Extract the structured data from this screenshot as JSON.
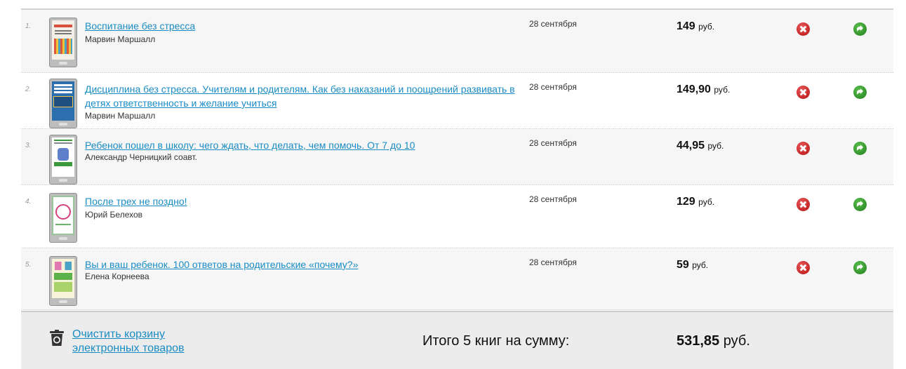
{
  "cart": {
    "items": [
      {
        "num": "1.",
        "title": "Воспитание без стресса",
        "author": "Марвин Маршалл",
        "date": "28 сентября",
        "price": "149",
        "currency": "руб."
      },
      {
        "num": "2.",
        "title": "Дисциплина без стресса. Учителям и родителям. Как без наказаний и поощрений развивать в детях ответственность и желание учиться",
        "author": "Марвин Маршалл",
        "date": "28 сентября",
        "price": "149,90",
        "currency": "руб."
      },
      {
        "num": "3.",
        "title": "Ребенок пошел в школу: чего ждать, что делать, чем помочь. От 7 до 10",
        "author": "Александр Черницкий соавт.",
        "date": "28 сентября",
        "price": "44,95",
        "currency": "руб."
      },
      {
        "num": "4.",
        "title": "После трех не поздно!",
        "author": "Юрий Белехов",
        "date": "28 сентября",
        "price": "129",
        "currency": "руб."
      },
      {
        "num": "5.",
        "title": "Вы и ваш ребенок. 100 ответов на родительские «почему?»",
        "author": "Елена Корнеева",
        "date": "28 сентября",
        "price": "59",
        "currency": "руб."
      }
    ]
  },
  "cover_covers": [
    {
      "bg": "#f3efe6",
      "accent": "#d7503a"
    },
    {
      "bg": "#2b6fae",
      "accent": "#ffffff"
    },
    {
      "bg": "#ffffff",
      "accent": "#3a9a3a"
    },
    {
      "bg": "#ffffff",
      "accent": "#d4417b"
    },
    {
      "bg": "#f7f3d8",
      "accent": "#5bb14a"
    }
  ],
  "footer": {
    "clear_label_line1": "Очистить корзину",
    "clear_label_line2": "электронных товаров",
    "total_label": "Итого 5 книг на сумму:",
    "total_value": "531,85",
    "total_currency": "руб."
  },
  "colors": {
    "link": "#1a8cc4",
    "delete": "#c41616",
    "forward": "#2e9b27"
  },
  "icons": [
    "delete-icon",
    "forward-icon",
    "recycle-bin-icon",
    "ebook-reader-icon"
  ]
}
